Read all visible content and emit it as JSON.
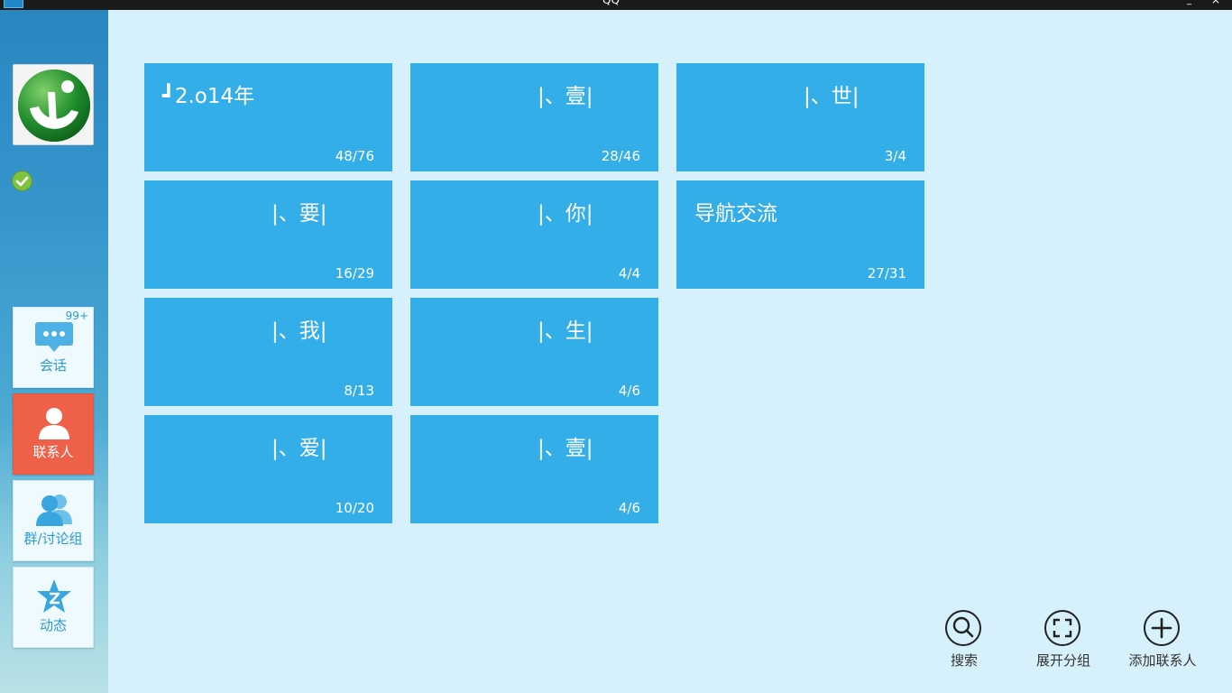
{
  "window": {
    "title": "QQ",
    "minimize": "_",
    "close": "×"
  },
  "sidebar": {
    "status": "online",
    "nav": [
      {
        "label": "会话",
        "badge": "99+",
        "icon": "chat-bubble-icon"
      },
      {
        "label": "联系人",
        "icon": "person-icon",
        "active": true
      },
      {
        "label": "群/讨论组",
        "icon": "group-icon"
      },
      {
        "label": "动态",
        "icon": "qzone-star-icon"
      }
    ]
  },
  "groups": [
    {
      "name": "┛2.o14年",
      "count": "48/76"
    },
    {
      "name": "|、壹|",
      "count": "28/46"
    },
    {
      "name": "|、世|",
      "count": "3/4"
    },
    {
      "name": "|、要|",
      "count": "16/29"
    },
    {
      "name": "|、你|",
      "count": "4/4"
    },
    {
      "name": "导航交流",
      "count": "27/31"
    },
    {
      "name": "|、我|",
      "count": "8/13"
    },
    {
      "name": "|、生|",
      "count": "4/6"
    },
    {
      "name": "|、爱|",
      "count": "10/20"
    },
    {
      "name": "|、壹|",
      "count": "4/6"
    }
  ],
  "actions": {
    "search": "搜索",
    "expand": "展开分组",
    "add": "添加联系人"
  },
  "colors": {
    "tile": "#34aee9",
    "active_nav": "#ee6148",
    "background": "#d6f0fc"
  }
}
